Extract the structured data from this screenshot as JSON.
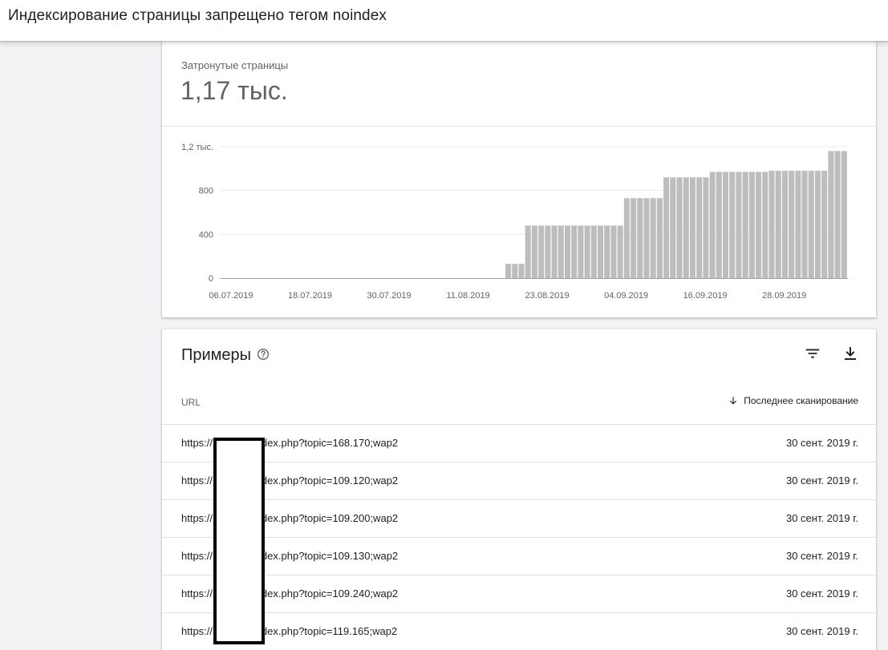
{
  "header": {
    "title": "Индексирование страницы запрещено тегом noindex"
  },
  "summary": {
    "label": "Затронутые страницы",
    "value": "1,17 тыс."
  },
  "chart_data": {
    "type": "bar",
    "ylim": [
      0,
      1200
    ],
    "yticks": [
      {
        "value": 0,
        "label": "0"
      },
      {
        "value": 400,
        "label": "400"
      },
      {
        "value": 800,
        "label": "800"
      },
      {
        "value": 1200,
        "label": "1,2 тыс."
      }
    ],
    "xticks": [
      "06.07.2019",
      "18.07.2019",
      "30.07.2019",
      "11.08.2019",
      "23.08.2019",
      "04.09.2019",
      "16.09.2019",
      "28.09.2019"
    ],
    "grid": true,
    "x_start": "06.07.2019",
    "x_end": "30.09.2019",
    "values": [
      0,
      0,
      0,
      0,
      0,
      0,
      0,
      0,
      0,
      0,
      0,
      0,
      0,
      0,
      0,
      0,
      0,
      0,
      0,
      0,
      0,
      0,
      0,
      0,
      0,
      0,
      0,
      0,
      0,
      0,
      0,
      0,
      0,
      0,
      0,
      0,
      0,
      0,
      0,
      0,
      0,
      0,
      0,
      130,
      130,
      130,
      480,
      480,
      480,
      480,
      480,
      480,
      480,
      480,
      480,
      480,
      480,
      480,
      480,
      480,
      480,
      730,
      730,
      730,
      730,
      730,
      730,
      920,
      920,
      920,
      920,
      920,
      920,
      920,
      970,
      970,
      970,
      970,
      970,
      970,
      970,
      970,
      970,
      980,
      980,
      980,
      980,
      980,
      980,
      980,
      980,
      980,
      1160,
      1160,
      1160
    ]
  },
  "examples": {
    "title": "Примеры",
    "col_url": "URL",
    "col_date": "Последнее сканирование",
    "rows": [
      {
        "url_prefix": "https://",
        "url_suffix": ".ru/index.php?topic=168.170;wap2",
        "date": "30 сент. 2019 г."
      },
      {
        "url_prefix": "https://",
        "url_suffix": ".ru/index.php?topic=109.120;wap2",
        "date": "30 сент. 2019 г."
      },
      {
        "url_prefix": "https://",
        "url_suffix": ".ru/index.php?topic=109.200;wap2",
        "date": "30 сент. 2019 г."
      },
      {
        "url_prefix": "https://",
        "url_suffix": ".ru/index.php?topic=109.130;wap2",
        "date": "30 сент. 2019 г."
      },
      {
        "url_prefix": "https://",
        "url_suffix": ".ru/index.php?topic=109.240;wap2",
        "date": "30 сент. 2019 г."
      },
      {
        "url_prefix": "https://",
        "url_suffix": ".ru/index.php?topic=119.165;wap2",
        "date": "30 сент. 2019 г."
      }
    ]
  },
  "icons": {
    "help": "help-circle-icon",
    "filter": "filter-icon",
    "download": "download-icon",
    "sort": "arrow-down-icon"
  },
  "colors": {
    "bar": "#bdbdbd",
    "grid": "#e8eaed",
    "axis": "#9e9e9e"
  }
}
